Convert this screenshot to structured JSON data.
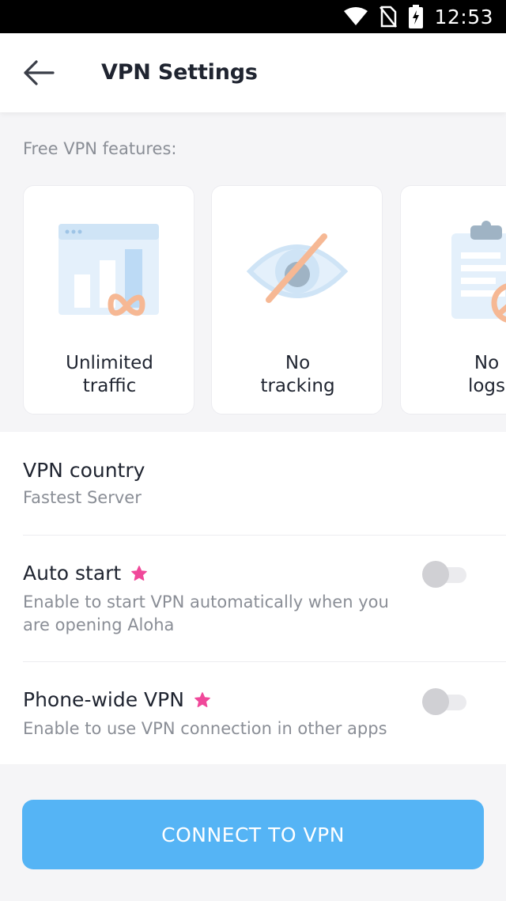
{
  "status_bar": {
    "time": "12:53"
  },
  "header": {
    "title": "VPN Settings"
  },
  "features": {
    "label": "Free VPN features:",
    "items": [
      {
        "line1": "Unlimited",
        "line2": "traffic",
        "icon": "unlimited-traffic-icon"
      },
      {
        "line1": "No",
        "line2": "tracking",
        "icon": "no-tracking-icon"
      },
      {
        "line1": "No",
        "line2": "logs",
        "icon": "no-logs-icon"
      }
    ]
  },
  "settings": {
    "country": {
      "title": "VPN country",
      "value": "Fastest Server"
    },
    "auto_start": {
      "title": "Auto start",
      "description": "Enable to start VPN automatically when you are opening Aloha",
      "enabled": false
    },
    "phone_wide": {
      "title": "Phone-wide VPN",
      "description": "Enable to use VPN connection in other apps",
      "enabled": false
    }
  },
  "connect_button": {
    "label": "CONNECT TO VPN"
  },
  "colors": {
    "accent": "#55b4f5",
    "star": "#f0489a",
    "illustration_orange": "#f6b894",
    "illustration_blue": "#cfe4f6"
  }
}
